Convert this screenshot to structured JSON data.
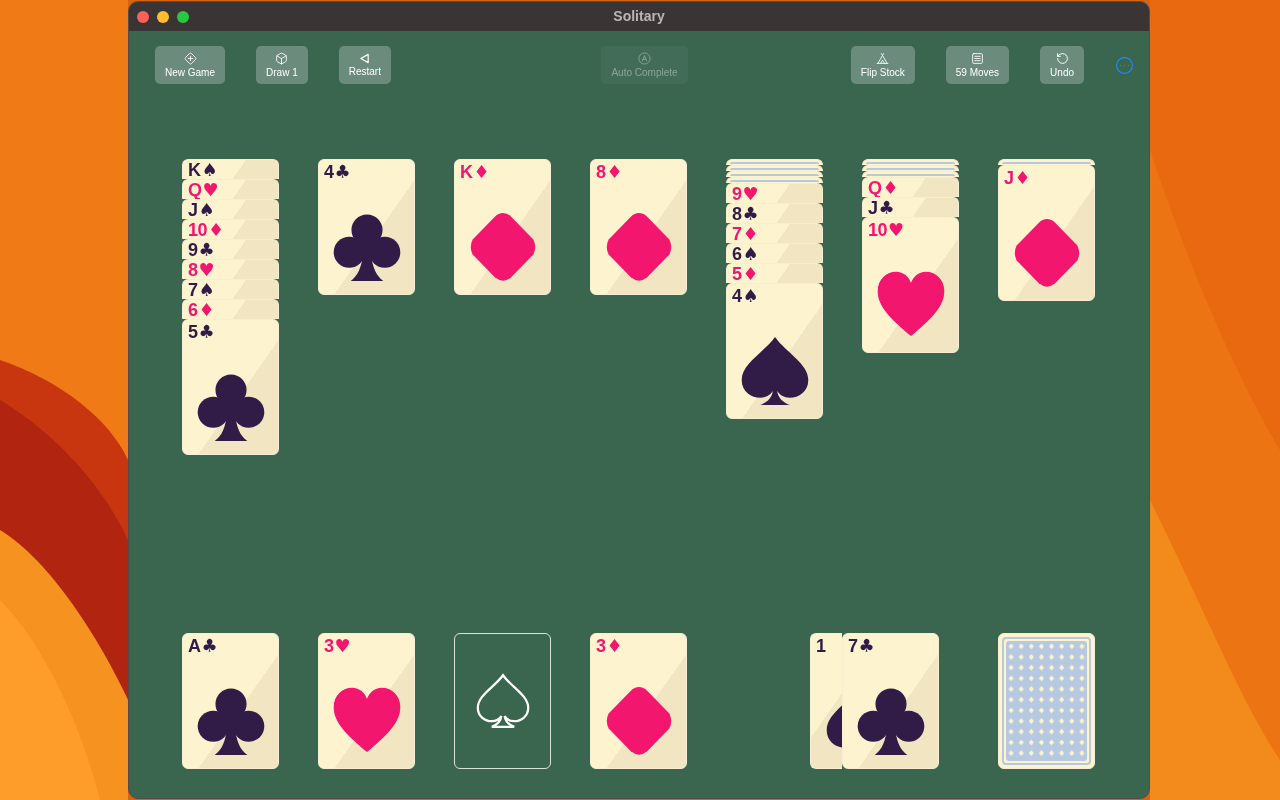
{
  "window": {
    "title": "Solitary"
  },
  "toolbar": {
    "left": [
      {
        "kind": "new-game",
        "label": "New Game",
        "disabled": false
      },
      {
        "kind": "draw",
        "label": "Draw 1",
        "disabled": false
      },
      {
        "kind": "restart",
        "label": "Restart",
        "disabled": false
      }
    ],
    "center": [
      {
        "kind": "auto-complete",
        "label": "Auto Complete",
        "disabled": true
      }
    ],
    "right": [
      {
        "kind": "flip-stock",
        "label": "Flip Stock",
        "disabled": false
      },
      {
        "kind": "moves",
        "label": "59 Moves",
        "disabled": false
      },
      {
        "kind": "undo",
        "label": "Undo",
        "disabled": false
      }
    ]
  },
  "tableau": [
    {
      "cards": [
        {
          "face_up": true,
          "rank": "K",
          "symbol": "♠",
          "color": "#301c47"
        },
        {
          "face_up": true,
          "rank": "Q",
          "symbol": "♥",
          "color": "#f2166e"
        },
        {
          "face_up": true,
          "rank": "J",
          "symbol": "♠",
          "color": "#301c47"
        },
        {
          "face_up": true,
          "rank": "10",
          "symbol": "♦",
          "color": "#f2166e"
        },
        {
          "face_up": true,
          "rank": "9",
          "symbol": "♣",
          "color": "#301c47"
        },
        {
          "face_up": true,
          "rank": "8",
          "symbol": "♥",
          "color": "#f2166e"
        },
        {
          "face_up": true,
          "rank": "7",
          "symbol": "♠",
          "color": "#301c47"
        },
        {
          "face_up": true,
          "rank": "6",
          "symbol": "♦",
          "color": "#f2166e"
        },
        {
          "face_up": true,
          "rank": "5",
          "symbol": "♣",
          "kind": "clubs",
          "color": "#301c47"
        }
      ]
    },
    {
      "cards": [
        {
          "face_up": true,
          "rank": "4",
          "symbol": "♣",
          "kind": "clubs",
          "color": "#301c47"
        }
      ]
    },
    {
      "cards": [
        {
          "face_up": true,
          "rank": "K",
          "symbol": "♦",
          "kind": "diamonds",
          "color": "#f2166e"
        }
      ]
    },
    {
      "cards": [
        {
          "face_up": true,
          "rank": "8",
          "symbol": "♦",
          "kind": "diamonds",
          "color": "#f2166e"
        }
      ]
    },
    {
      "cards": [
        {
          "face_up": false
        },
        {
          "face_up": false
        },
        {
          "face_up": false
        },
        {
          "face_up": false
        },
        {
          "face_up": true,
          "rank": "9",
          "symbol": "♥",
          "color": "#f2166e"
        },
        {
          "face_up": true,
          "rank": "8",
          "symbol": "♣",
          "color": "#301c47"
        },
        {
          "face_up": true,
          "rank": "7",
          "symbol": "♦",
          "color": "#f2166e"
        },
        {
          "face_up": true,
          "rank": "6",
          "symbol": "♠",
          "color": "#301c47"
        },
        {
          "face_up": true,
          "rank": "5",
          "symbol": "♦",
          "color": "#f2166e"
        },
        {
          "face_up": true,
          "rank": "4",
          "symbol": "♠",
          "kind": "spades",
          "color": "#301c47"
        }
      ]
    },
    {
      "cards": [
        {
          "face_up": false
        },
        {
          "face_up": false
        },
        {
          "face_up": false
        },
        {
          "face_up": true,
          "rank": "Q",
          "symbol": "♦",
          "color": "#f2166e"
        },
        {
          "face_up": true,
          "rank": "J",
          "symbol": "♣",
          "color": "#301c47"
        },
        {
          "face_up": true,
          "rank": "10",
          "symbol": "♥",
          "kind": "hearts",
          "color": "#f2166e"
        }
      ]
    },
    {
      "cards": [
        {
          "face_up": false
        },
        {
          "face_up": true,
          "rank": "J",
          "symbol": "♦",
          "kind": "diamonds",
          "color": "#f2166e"
        }
      ]
    }
  ],
  "foundations": [
    {
      "kind": "clubs",
      "rank": "A",
      "symbol": "♣",
      "color": "#301c47"
    },
    {
      "kind": "hearts",
      "rank": "3",
      "symbol": "♥",
      "color": "#f2166e"
    },
    {
      "kind": "empty-spades"
    },
    {
      "kind": "diamonds",
      "rank": "3",
      "symbol": "♦",
      "color": "#f2166e"
    }
  ],
  "waste": [
    {
      "kind": "spades",
      "rank": "1",
      "color": "#301c47"
    },
    {
      "kind": "clubs",
      "rank": "7",
      "symbol": "♣",
      "color": "#301c47"
    }
  ],
  "stock": {
    "empty": false
  }
}
